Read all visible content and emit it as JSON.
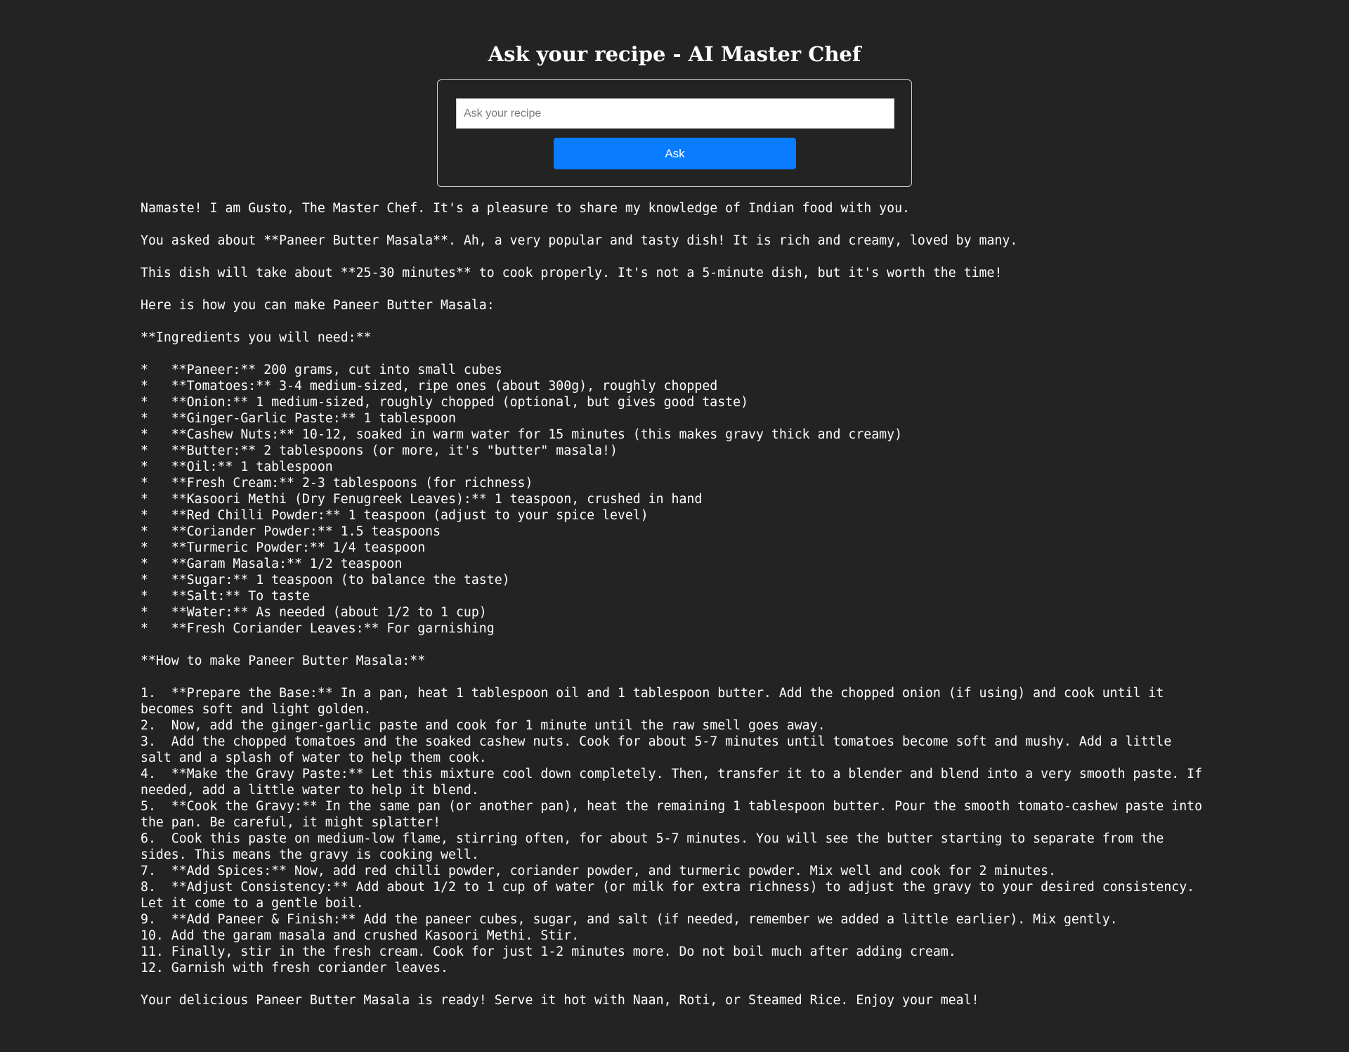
{
  "page": {
    "title": "Ask your recipe - AI Master Chef"
  },
  "form": {
    "input_value": "",
    "input_placeholder": "Ask your recipe",
    "button_label": "Ask"
  },
  "response": {
    "text": "Namaste! I am Gusto, The Master Chef. It's a pleasure to share my knowledge of Indian food with you.\n\nYou asked about **Paneer Butter Masala**. Ah, a very popular and tasty dish! It is rich and creamy, loved by many.\n\nThis dish will take about **25-30 minutes** to cook properly. It's not a 5-minute dish, but it's worth the time!\n\nHere is how you can make Paneer Butter Masala:\n\n**Ingredients you will need:**\n\n*   **Paneer:** 200 grams, cut into small cubes\n*   **Tomatoes:** 3-4 medium-sized, ripe ones (about 300g), roughly chopped\n*   **Onion:** 1 medium-sized, roughly chopped (optional, but gives good taste)\n*   **Ginger-Garlic Paste:** 1 tablespoon\n*   **Cashew Nuts:** 10-12, soaked in warm water for 15 minutes (this makes gravy thick and creamy)\n*   **Butter:** 2 tablespoons (or more, it's \"butter\" masala!)\n*   **Oil:** 1 tablespoon\n*   **Fresh Cream:** 2-3 tablespoons (for richness)\n*   **Kasoori Methi (Dry Fenugreek Leaves):** 1 teaspoon, crushed in hand\n*   **Red Chilli Powder:** 1 teaspoon (adjust to your spice level)\n*   **Coriander Powder:** 1.5 teaspoons\n*   **Turmeric Powder:** 1/4 teaspoon\n*   **Garam Masala:** 1/2 teaspoon\n*   **Sugar:** 1 teaspoon (to balance the taste)\n*   **Salt:** To taste\n*   **Water:** As needed (about 1/2 to 1 cup)\n*   **Fresh Coriander Leaves:** For garnishing\n\n**How to make Paneer Butter Masala:**\n\n1.  **Prepare the Base:** In a pan, heat 1 tablespoon oil and 1 tablespoon butter. Add the chopped onion (if using) and cook until it becomes soft and light golden.\n2.  Now, add the ginger-garlic paste and cook for 1 minute until the raw smell goes away.\n3.  Add the chopped tomatoes and the soaked cashew nuts. Cook for about 5-7 minutes until tomatoes become soft and mushy. Add a little salt and a splash of water to help them cook.\n4.  **Make the Gravy Paste:** Let this mixture cool down completely. Then, transfer it to a blender and blend into a very smooth paste. If needed, add a little water to help it blend.\n5.  **Cook the Gravy:** In the same pan (or another pan), heat the remaining 1 tablespoon butter. Pour the smooth tomato-cashew paste into the pan. Be careful, it might splatter!\n6.  Cook this paste on medium-low flame, stirring often, for about 5-7 minutes. You will see the butter starting to separate from the sides. This means the gravy is cooking well.\n7.  **Add Spices:** Now, add red chilli powder, coriander powder, and turmeric powder. Mix well and cook for 2 minutes.\n8.  **Adjust Consistency:** Add about 1/2 to 1 cup of water (or milk for extra richness) to adjust the gravy to your desired consistency. Let it come to a gentle boil.\n9.  **Add Paneer & Finish:** Add the paneer cubes, sugar, and salt (if needed, remember we added a little earlier). Mix gently.\n10. Add the garam masala and crushed Kasoori Methi. Stir.\n11. Finally, stir in the fresh cream. Cook for just 1-2 minutes more. Do not boil much after adding cream.\n12. Garnish with fresh coriander leaves.\n\nYour delicious Paneer Butter Masala is ready! Serve it hot with Naan, Roti, or Steamed Rice. Enjoy your meal!"
  },
  "colors": {
    "background": "#232323",
    "text": "#ffffff",
    "button": "#0a7cff",
    "form_border": "#cfcfcf"
  }
}
